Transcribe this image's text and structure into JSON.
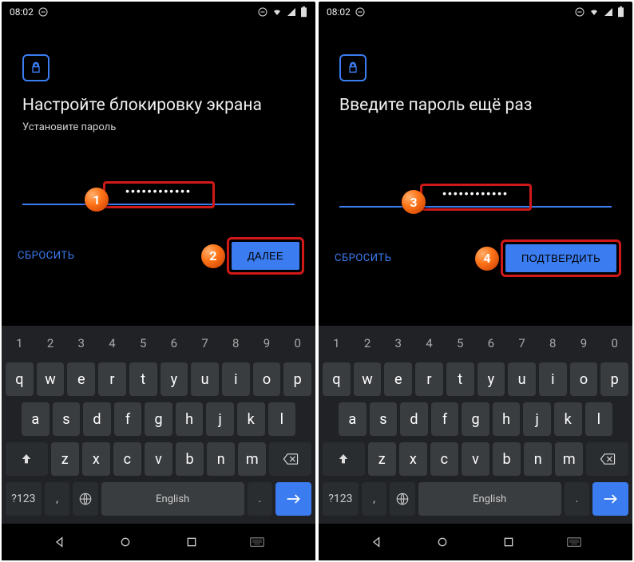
{
  "left": {
    "statusbar": {
      "time": "08:02"
    },
    "heading": "Настройте блокировку экрана",
    "subheading": "Установите пароль",
    "password_value": "••••••••••••",
    "reset_label": "СБРОСИТЬ",
    "next_label": "ДАЛЕЕ",
    "marker_input": "1",
    "marker_button": "2"
  },
  "right": {
    "statusbar": {
      "time": "08:02"
    },
    "heading": "Введите пароль ещё раз",
    "subheading": "",
    "password_value": "••••••••••••",
    "reset_label": "СБРОСИТЬ",
    "next_label": "ПОДТВЕРДИТЬ",
    "marker_input": "3",
    "marker_button": "4"
  },
  "keyboard": {
    "num_row": [
      "1",
      "2",
      "3",
      "4",
      "5",
      "6",
      "7",
      "8",
      "9",
      "0"
    ],
    "row1": [
      "q",
      "w",
      "e",
      "r",
      "t",
      "y",
      "u",
      "i",
      "o",
      "p"
    ],
    "row2": [
      "a",
      "s",
      "d",
      "f",
      "g",
      "h",
      "j",
      "k",
      "l"
    ],
    "row3": [
      "z",
      "x",
      "c",
      "v",
      "b",
      "n",
      "m"
    ],
    "sym_label": "?123",
    "comma": ",",
    "period": ".",
    "space_label": "English"
  }
}
